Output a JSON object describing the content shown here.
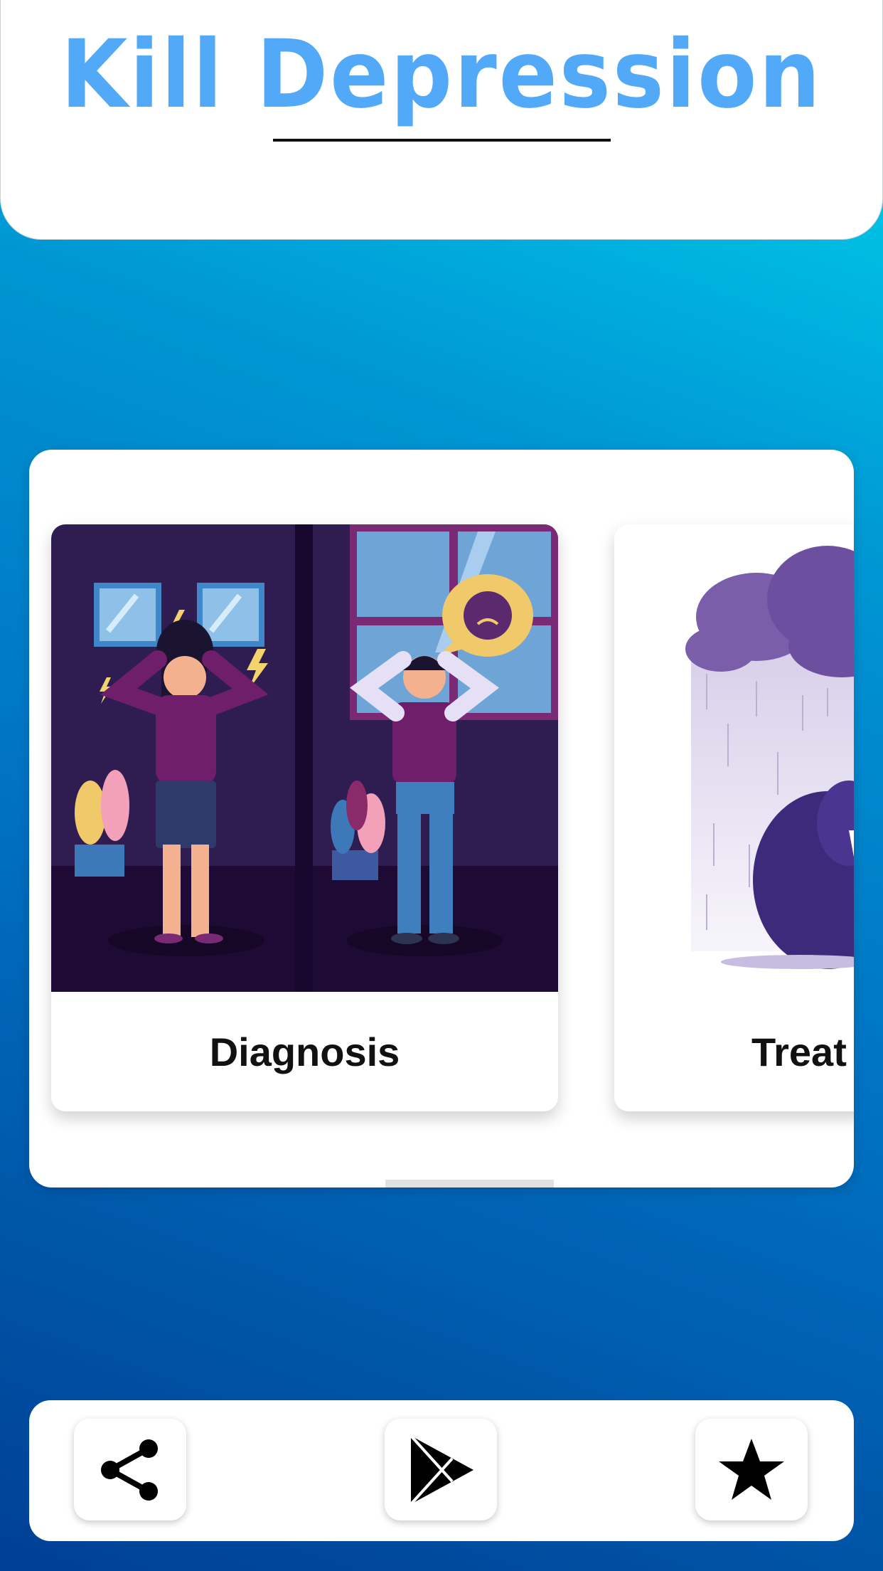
{
  "header": {
    "title": "Kill Depression"
  },
  "carousel": {
    "cards": [
      {
        "label": "Diagnosis"
      },
      {
        "label": "Treat"
      }
    ]
  },
  "bottom_bar": {
    "buttons": [
      {
        "icon": "share-icon"
      },
      {
        "icon": "play-store-icon"
      },
      {
        "icon": "star-icon"
      }
    ]
  },
  "colors": {
    "title": "#52a9f7",
    "background_top": "#00d9ee",
    "background_bottom": "#003f94"
  }
}
